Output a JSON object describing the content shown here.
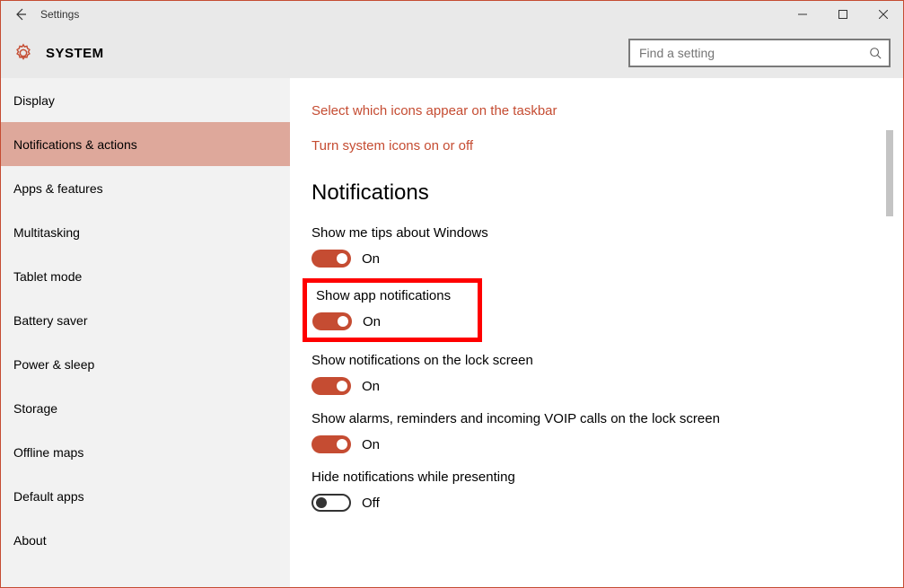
{
  "window": {
    "title": "Settings"
  },
  "header": {
    "title": "SYSTEM",
    "search_placeholder": "Find a setting"
  },
  "sidebar": {
    "items": [
      {
        "label": "Display"
      },
      {
        "label": "Notifications & actions"
      },
      {
        "label": "Apps & features"
      },
      {
        "label": "Multitasking"
      },
      {
        "label": "Tablet mode"
      },
      {
        "label": "Battery saver"
      },
      {
        "label": "Power & sleep"
      },
      {
        "label": "Storage"
      },
      {
        "label": "Offline maps"
      },
      {
        "label": "Default apps"
      },
      {
        "label": "About"
      }
    ],
    "active_index": 1
  },
  "content": {
    "links": [
      {
        "label": "Select which icons appear on the taskbar"
      },
      {
        "label": "Turn system icons on or off"
      }
    ],
    "section_title": "Notifications",
    "settings": [
      {
        "label": "Show me tips about Windows",
        "state": "On",
        "on": true,
        "highlighted": false
      },
      {
        "label": "Show app notifications",
        "state": "On",
        "on": true,
        "highlighted": true
      },
      {
        "label": "Show notifications on the lock screen",
        "state": "On",
        "on": true,
        "highlighted": false
      },
      {
        "label": "Show alarms, reminders and incoming VOIP calls on the lock screen",
        "state": "On",
        "on": true,
        "highlighted": false
      },
      {
        "label": "Hide notifications while presenting",
        "state": "Off",
        "on": false,
        "highlighted": false
      }
    ]
  }
}
